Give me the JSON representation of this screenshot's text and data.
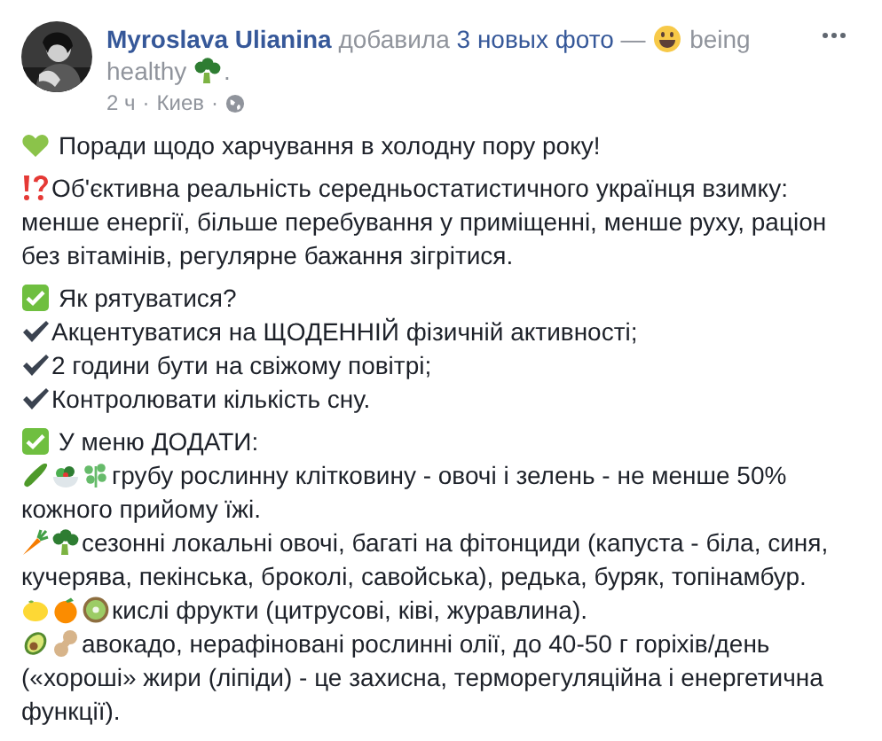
{
  "header": {
    "author": "Myroslava Ulianina",
    "action": "добавила",
    "photos_link": "3 новых фото",
    "dash": "—",
    "feeling_first": "being",
    "feeling_rest": "healthy",
    "end": "."
  },
  "meta": [
    "2 ч",
    "·",
    "Киев",
    "·"
  ],
  "paragraphs": [
    {
      "lines": [
        {
          "rows": [
            "Поради щодо харчування в холодну пору року!"
          ]
        }
      ]
    },
    {
      "lines": [
        {
          "rows": [
            "Об'єктивна реальність середньостатистичного українця взимку:",
            "менше енергії, більше перебування у приміщенні, менше руху, раціон",
            "без вітамінів, регулярне бажання зігрітися."
          ]
        }
      ]
    },
    {
      "lines": [
        {
          "rows": [
            "Як рятуватися?"
          ]
        },
        {
          "rows": [
            "Акцентуватися на ЩОДЕННІЙ фізичній активності;"
          ]
        },
        {
          "rows": [
            "2 години бути на свіжому повітрі;"
          ]
        },
        {
          "rows": [
            "Контролювати кількість сну."
          ]
        }
      ]
    },
    {
      "lines": [
        {
          "rows": [
            "У меню ДОДАТИ:"
          ]
        },
        {
          "rows": [
            "грубу рослинну клітковину - овочі і зелень - не менше 50%",
            "кожного прийому їжі."
          ]
        },
        {
          "rows": [
            "сезонні локальні овочі, багаті на фітонциди (капуста - біла, синя,",
            "кучерява, пекінська, броколі, савойська), редька, буряк, топінамбур."
          ]
        },
        {
          "rows": [
            "кислі фрукти (цитрусові, ківі, журавлина)."
          ]
        },
        {
          "rows": [
            "авокадо, нерафіновані рослинні олії, до 40-50 г горіхів/день",
            "(«хороші» жири (ліпіди) - це захисна, терморегуляційна і енергетична",
            "функції)."
          ]
        }
      ]
    }
  ]
}
